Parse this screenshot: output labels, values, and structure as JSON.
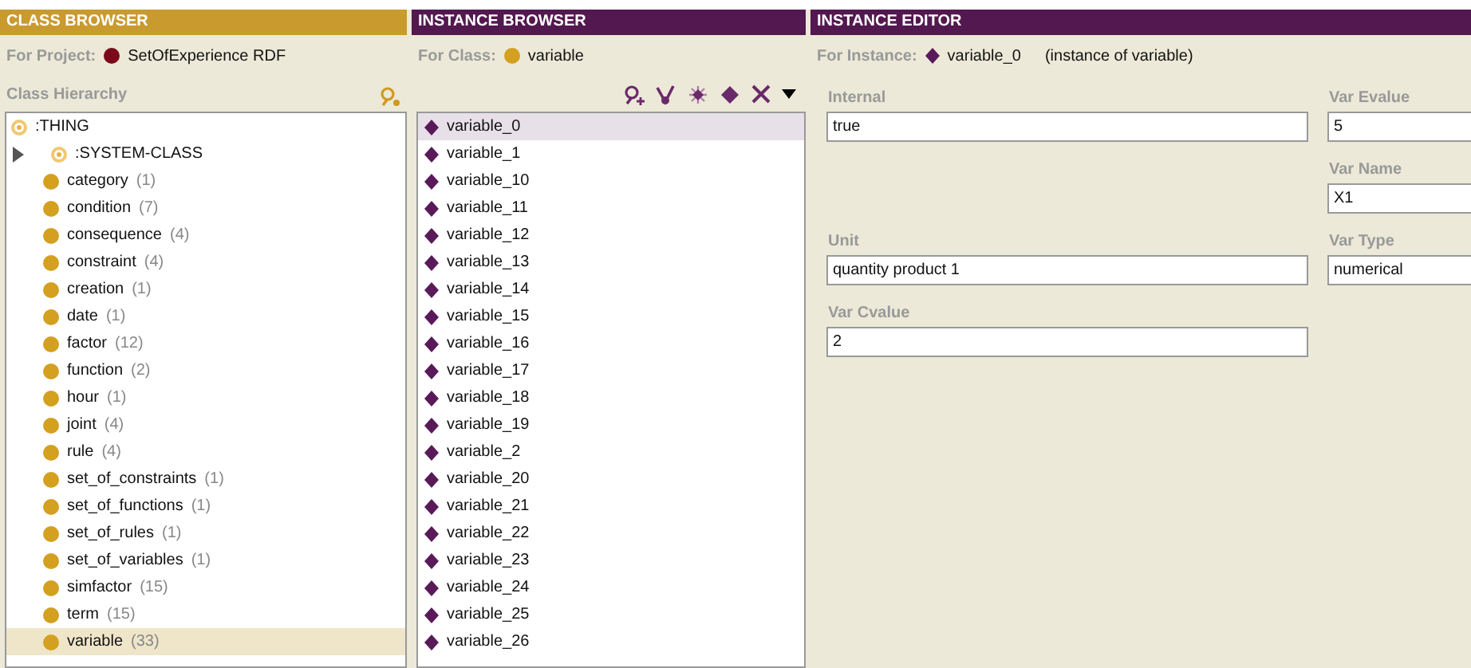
{
  "class_browser": {
    "title": "CLASS BROWSER",
    "project_label": "For Project:",
    "project": "SetOfExperience RDF",
    "hierarchy_label": "Class Hierarchy",
    "tree": [
      {
        "label": ":THING",
        "kind": "system",
        "selected": false,
        "children": [
          {
            "label": ":SYSTEM-CLASS",
            "kind": "system",
            "selected": false,
            "expanded": false
          },
          {
            "label": "category",
            "count": "(1)",
            "kind": "class",
            "selected": false
          },
          {
            "label": "condition",
            "count": "(7)",
            "kind": "class",
            "selected": false
          },
          {
            "label": "consequence",
            "count": "(4)",
            "kind": "class",
            "selected": false
          },
          {
            "label": "constraint",
            "count": "(4)",
            "kind": "class",
            "selected": false
          },
          {
            "label": "creation",
            "count": "(1)",
            "kind": "class",
            "selected": false
          },
          {
            "label": "date",
            "count": "(1)",
            "kind": "class",
            "selected": false
          },
          {
            "label": "factor",
            "count": "(12)",
            "kind": "class",
            "selected": false
          },
          {
            "label": "function",
            "count": "(2)",
            "kind": "class",
            "selected": false
          },
          {
            "label": "hour",
            "count": "(1)",
            "kind": "class",
            "selected": false
          },
          {
            "label": "joint",
            "count": "(4)",
            "kind": "class",
            "selected": false
          },
          {
            "label": "rule",
            "count": "(4)",
            "kind": "class",
            "selected": false
          },
          {
            "label": "set_of_constraints",
            "count": "(1)",
            "kind": "class",
            "selected": false
          },
          {
            "label": "set_of_functions",
            "count": "(1)",
            "kind": "class",
            "selected": false
          },
          {
            "label": "set_of_rules",
            "count": "(1)",
            "kind": "class",
            "selected": false
          },
          {
            "label": "set_of_variables",
            "count": "(1)",
            "kind": "class",
            "selected": false
          },
          {
            "label": "simfactor",
            "count": "(15)",
            "kind": "class",
            "selected": false
          },
          {
            "label": "term",
            "count": "(15)",
            "kind": "class",
            "selected": false
          },
          {
            "label": "variable",
            "count": "(33)",
            "kind": "class",
            "selected": true
          }
        ]
      }
    ]
  },
  "instance_browser": {
    "title": "INSTANCE BROWSER",
    "class_label": "For Class:",
    "class_name": "variable",
    "instances": [
      {
        "label": "variable_0",
        "selected": true
      },
      {
        "label": "variable_1",
        "selected": false
      },
      {
        "label": "variable_10",
        "selected": false
      },
      {
        "label": "variable_11",
        "selected": false
      },
      {
        "label": "variable_12",
        "selected": false
      },
      {
        "label": "variable_13",
        "selected": false
      },
      {
        "label": "variable_14",
        "selected": false
      },
      {
        "label": "variable_15",
        "selected": false
      },
      {
        "label": "variable_16",
        "selected": false
      },
      {
        "label": "variable_17",
        "selected": false
      },
      {
        "label": "variable_18",
        "selected": false
      },
      {
        "label": "variable_19",
        "selected": false
      },
      {
        "label": "variable_2",
        "selected": false
      },
      {
        "label": "variable_20",
        "selected": false
      },
      {
        "label": "variable_21",
        "selected": false
      },
      {
        "label": "variable_22",
        "selected": false
      },
      {
        "label": "variable_23",
        "selected": false
      },
      {
        "label": "variable_24",
        "selected": false
      },
      {
        "label": "variable_25",
        "selected": false
      },
      {
        "label": "variable_26",
        "selected": false
      }
    ]
  },
  "instance_editor": {
    "title": "INSTANCE EDITOR",
    "instance_label": "For Instance:",
    "instance": "variable_0",
    "instance_of": "(instance of variable)",
    "rows": [
      {
        "left": {
          "label": "Internal",
          "value": "true"
        },
        "right": {
          "label": "Var Evalue",
          "value": "5"
        }
      },
      {
        "right": {
          "label": "Var Name",
          "value": "X1"
        }
      },
      {
        "left": {
          "label": "Unit",
          "value": "quantity product 1"
        },
        "right": {
          "label": "Var Type",
          "value": "numerical"
        }
      },
      {
        "left": {
          "label": "Var Cvalue",
          "value": "2"
        }
      }
    ]
  }
}
